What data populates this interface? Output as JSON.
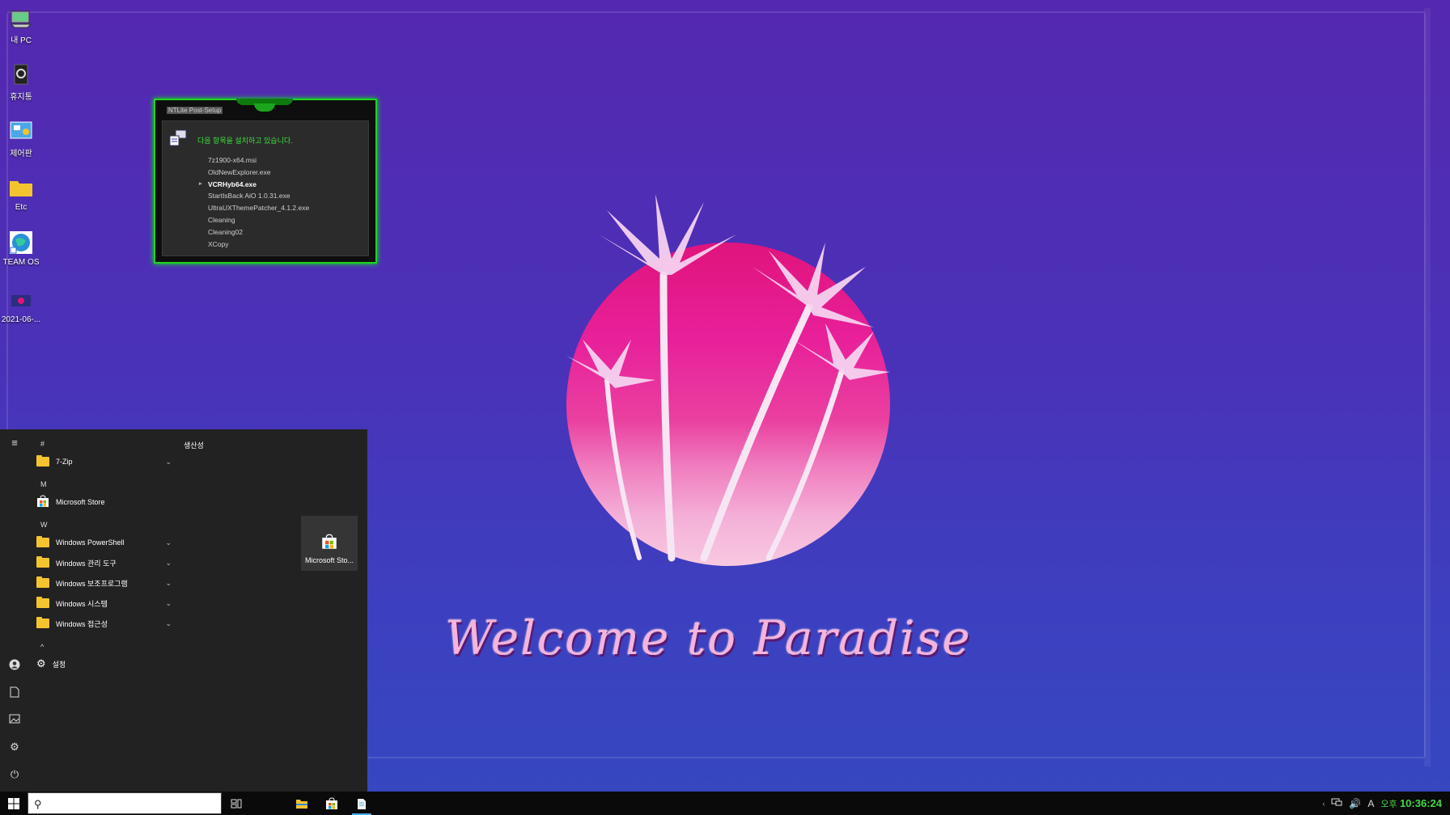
{
  "desktop": {
    "icons": [
      {
        "label": "내 PC",
        "icon": "computer-icon"
      },
      {
        "label": "휴지통",
        "icon": "recycle-bin-icon"
      },
      {
        "label": "제어판",
        "icon": "control-panel-icon"
      },
      {
        "label": "Etc",
        "icon": "folder-icon"
      },
      {
        "label": "TEAM OS",
        "icon": "globe-shortcut-icon"
      },
      {
        "label": "2021-06-...",
        "icon": "image-file-icon"
      }
    ]
  },
  "wallpaper": {
    "text": "Welcome to Paradise"
  },
  "ntlite": {
    "title": "NTLite Post-Setup",
    "header": "다음 항목을 설치하고 있습니다.",
    "items": [
      "7z1900-x64.msi",
      "OldNewExplorer.exe",
      "VCRHyb64.exe",
      "StartIsBack AiO 1.0.31.exe",
      "UltraUXThemePatcher_4.1.2.exe",
      "Cleaning",
      "Cleaning02",
      "XCopy"
    ],
    "current_index": 2
  },
  "start_menu": {
    "letters": {
      "hash": "#",
      "m": "M",
      "w": "W",
      "up": "^"
    },
    "apps": {
      "zip": "7-Zip",
      "store": "Microsoft Store",
      "powershell": "Windows PowerShell",
      "admin": "Windows 관리 도구",
      "accessories": "Windows 보조프로그램",
      "system": "Windows 시스템",
      "access": "Windows 접근성",
      "settings": "설정"
    },
    "tiles_group": "생산성",
    "tile_label": "Microsoft Sto..."
  },
  "taskbar": {
    "search_value": "",
    "ime": "A",
    "ampm": "오후",
    "time": "10:36:24"
  },
  "colors": {
    "accent_green": "#1fd41f",
    "clock": "#46d846",
    "start_bg": "#222222"
  }
}
